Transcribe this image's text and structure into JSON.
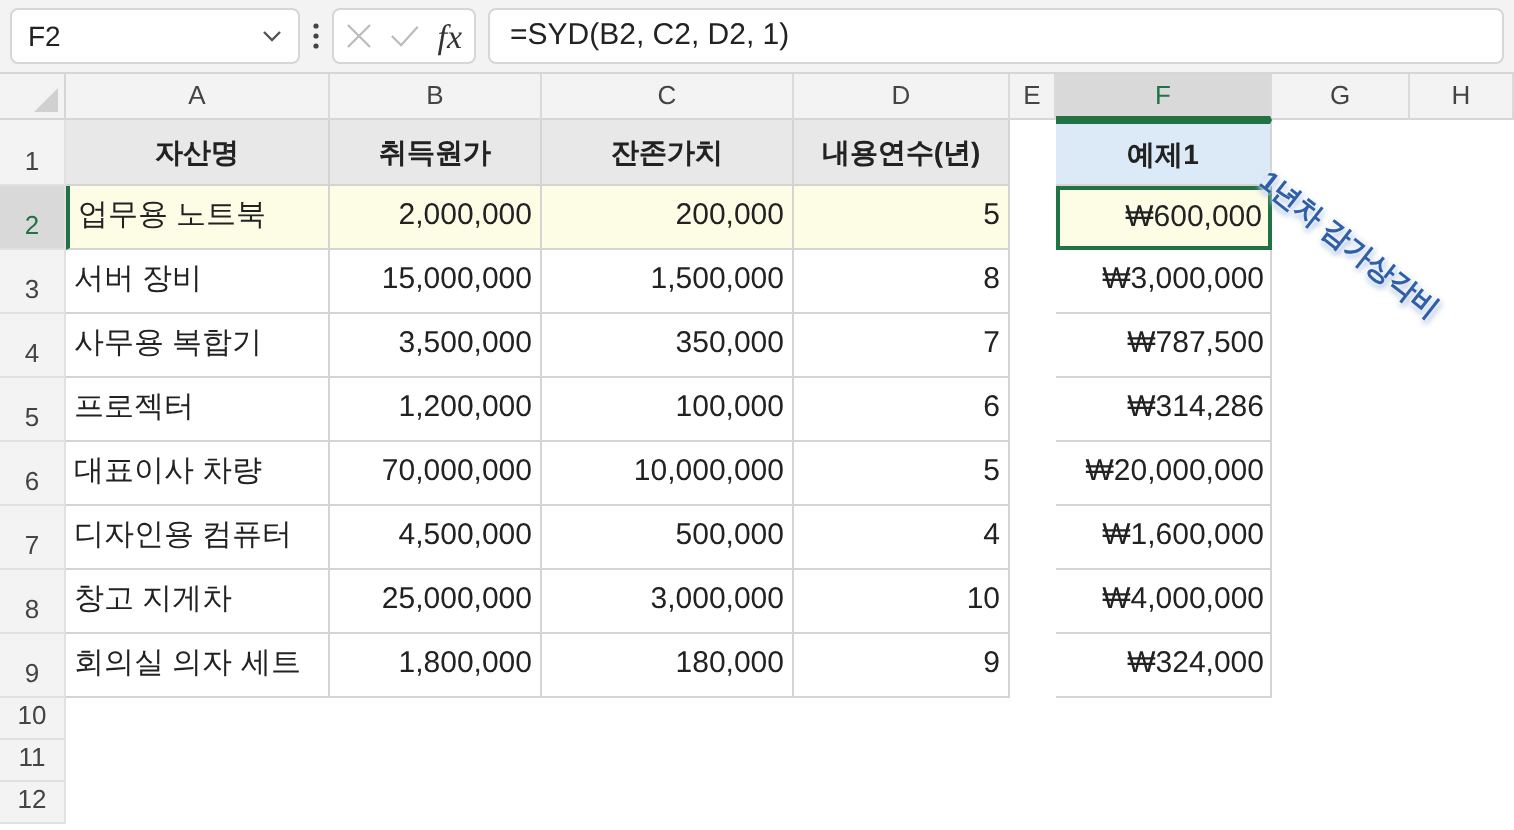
{
  "name_box": {
    "value": "F2"
  },
  "formula_bar": {
    "fx": "fx",
    "formula": "=SYD(B2, C2, D2, 1)"
  },
  "columns": [
    {
      "label": "A",
      "selected": false
    },
    {
      "label": "B",
      "selected": false
    },
    {
      "label": "C",
      "selected": false
    },
    {
      "label": "D",
      "selected": false
    },
    {
      "label": "E",
      "selected": false
    },
    {
      "label": "F",
      "selected": true
    },
    {
      "label": "G",
      "selected": false
    },
    {
      "label": "H",
      "selected": false
    }
  ],
  "row_numbers": [
    {
      "label": "1",
      "selected": false
    },
    {
      "label": "2",
      "selected": true
    },
    {
      "label": "3",
      "selected": false
    },
    {
      "label": "4",
      "selected": false
    },
    {
      "label": "5",
      "selected": false
    },
    {
      "label": "6",
      "selected": false
    },
    {
      "label": "7",
      "selected": false
    },
    {
      "label": "8",
      "selected": false
    },
    {
      "label": "9",
      "selected": false
    },
    {
      "label": "10",
      "selected": false
    },
    {
      "label": "11",
      "selected": false
    },
    {
      "label": "12",
      "selected": false
    }
  ],
  "table": {
    "headers": [
      "자산명",
      "취득원가",
      "잔존가치",
      "내용연수(년)"
    ],
    "rows": [
      {
        "cells": [
          "업무용 노트북",
          "2,000,000",
          "200,000",
          "5"
        ],
        "highlighted": true
      },
      {
        "cells": [
          "서버 장비",
          "15,000,000",
          "1,500,000",
          "8"
        ],
        "highlighted": false
      },
      {
        "cells": [
          "사무용 복합기",
          "3,500,000",
          "350,000",
          "7"
        ],
        "highlighted": false
      },
      {
        "cells": [
          "프로젝터",
          "1,200,000",
          "100,000",
          "6"
        ],
        "highlighted": false
      },
      {
        "cells": [
          "대표이사 차량",
          "70,000,000",
          "10,000,000",
          "5"
        ],
        "highlighted": false
      },
      {
        "cells": [
          "디자인용 컴퓨터",
          "4,500,000",
          "500,000",
          "4"
        ],
        "highlighted": false
      },
      {
        "cells": [
          "창고 지게차",
          "25,000,000",
          "3,000,000",
          "10"
        ],
        "highlighted": false
      },
      {
        "cells": [
          "회의실 의자 세트",
          "1,800,000",
          "180,000",
          "9"
        ],
        "highlighted": false
      }
    ]
  },
  "result": {
    "header": "예제1",
    "values": [
      {
        "value": "₩600,000",
        "selected": true
      },
      {
        "value": "₩3,000,000",
        "selected": false
      },
      {
        "value": "₩787,500",
        "selected": false
      },
      {
        "value": "₩314,286",
        "selected": false
      },
      {
        "value": "₩20,000,000",
        "selected": false
      },
      {
        "value": "₩1,600,000",
        "selected": false
      },
      {
        "value": "₩4,000,000",
        "selected": false
      },
      {
        "value": "₩324,000",
        "selected": false
      }
    ]
  },
  "annotation": {
    "text": "1년차 감가상각비"
  }
}
